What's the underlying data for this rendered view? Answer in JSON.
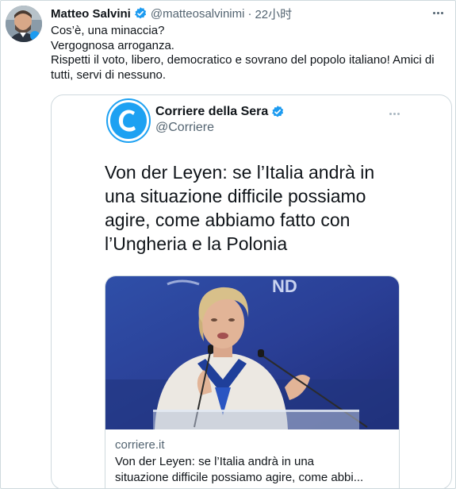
{
  "tweet": {
    "author_name": "Matteo Salvini",
    "handle": "@matteosalvinimi",
    "separator": "·",
    "time": "22小时",
    "body_lines": [
      "Cos’è, una minaccia?",
      "Vergognosa arroganza.",
      "Rispetti il voto, libero, democratico e sovrano del popolo italiano! Amici di",
      "tutti, servi di nessuno."
    ]
  },
  "quoted": {
    "author_name": "Corriere della Sera",
    "handle": "@Corriere",
    "text_lines": [
      "Von der Leyen: se l’Italia andrà in",
      "una situazione difficile possiamo",
      "agire, come abbiamo fatto con",
      "l’Ungheria e la Polonia"
    ],
    "card": {
      "domain": "corriere.it",
      "title_lines": [
        "Von der Leyen: se l’Italia andrà in una",
        "situazione difficile possiamo agire, come abbi..."
      ],
      "backdrop_text": "ND"
    }
  },
  "colors": {
    "verified": "#1d9bf0",
    "text_primary": "#0f1419",
    "text_secondary": "#536471",
    "border": "#cfd9de",
    "brand_corriere": "#1da1f2"
  },
  "icons": {
    "verified": "verified-badge-icon",
    "more": "more-icon",
    "corriere_logo": "corriere-c-logo"
  }
}
